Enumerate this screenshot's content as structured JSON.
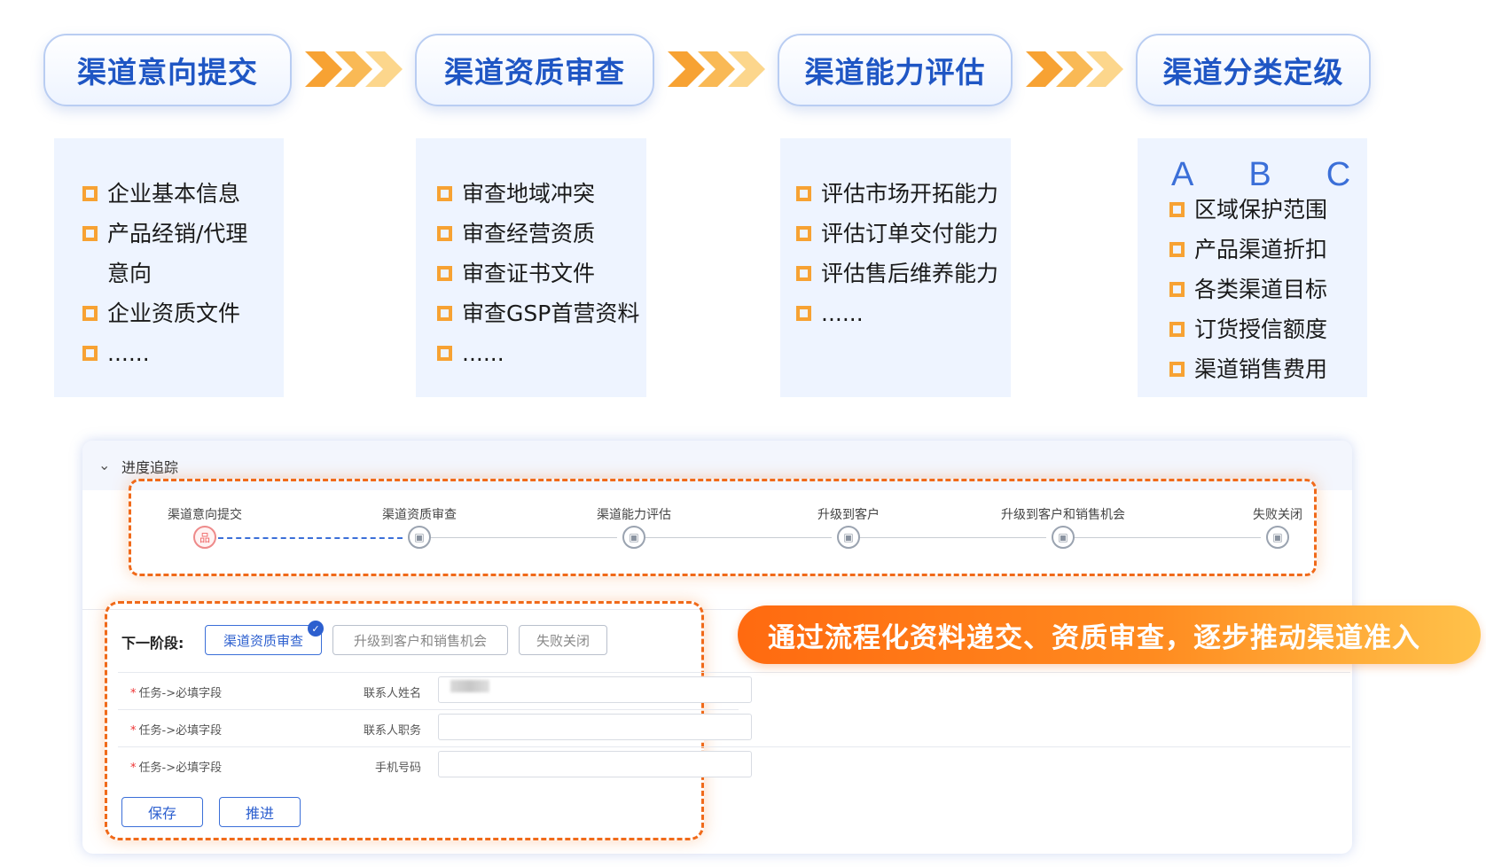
{
  "stages": [
    {
      "title": "渠道意向提交",
      "items": [
        "企业基本信息",
        "产品经销/代理意向",
        "企业资质文件",
        "......"
      ]
    },
    {
      "title": "渠道资质审查",
      "items": [
        "审查地域冲突",
        "审查经营资质",
        "审查证书文件",
        "审查GSP首营资料",
        "......"
      ]
    },
    {
      "title": "渠道能力评估",
      "items": [
        "评估市场开拓能力",
        "评估订单交付能力",
        "评估售后维养能力",
        "......"
      ]
    },
    {
      "title": "渠道分类定级",
      "grades": [
        "A",
        "B",
        "C"
      ],
      "items": [
        "区域保护范围",
        "产品渠道折扣",
        "各类渠道目标",
        "订货授信额度",
        "渠道销售费用"
      ]
    }
  ],
  "tracker": {
    "title": "进度追踪",
    "steps": [
      "渠道意向提交",
      "渠道资质审查",
      "渠道能力评估",
      "升级到客户",
      "升级到客户和销售机会",
      "失败关闭"
    ],
    "active_icon": "品"
  },
  "form": {
    "next_stage_label": "下一阶段:",
    "options": [
      "渠道资质审查",
      "升级到客户和销售机会",
      "失败关闭"
    ],
    "rows": [
      {
        "required": "任务->必填字段",
        "label": "联系人姓名"
      },
      {
        "required": "任务->必填字段",
        "label": "联系人职务"
      },
      {
        "required": "任务->必填字段",
        "label": "手机号码"
      }
    ],
    "save": "保存",
    "advance": "推进"
  },
  "banner": "通过流程化资料递交、资质审查，逐步推动渠道准入",
  "colors": {
    "accent_blue": "#1f56c4",
    "orange": "#f06a1a",
    "bullet": "#f7a233"
  }
}
